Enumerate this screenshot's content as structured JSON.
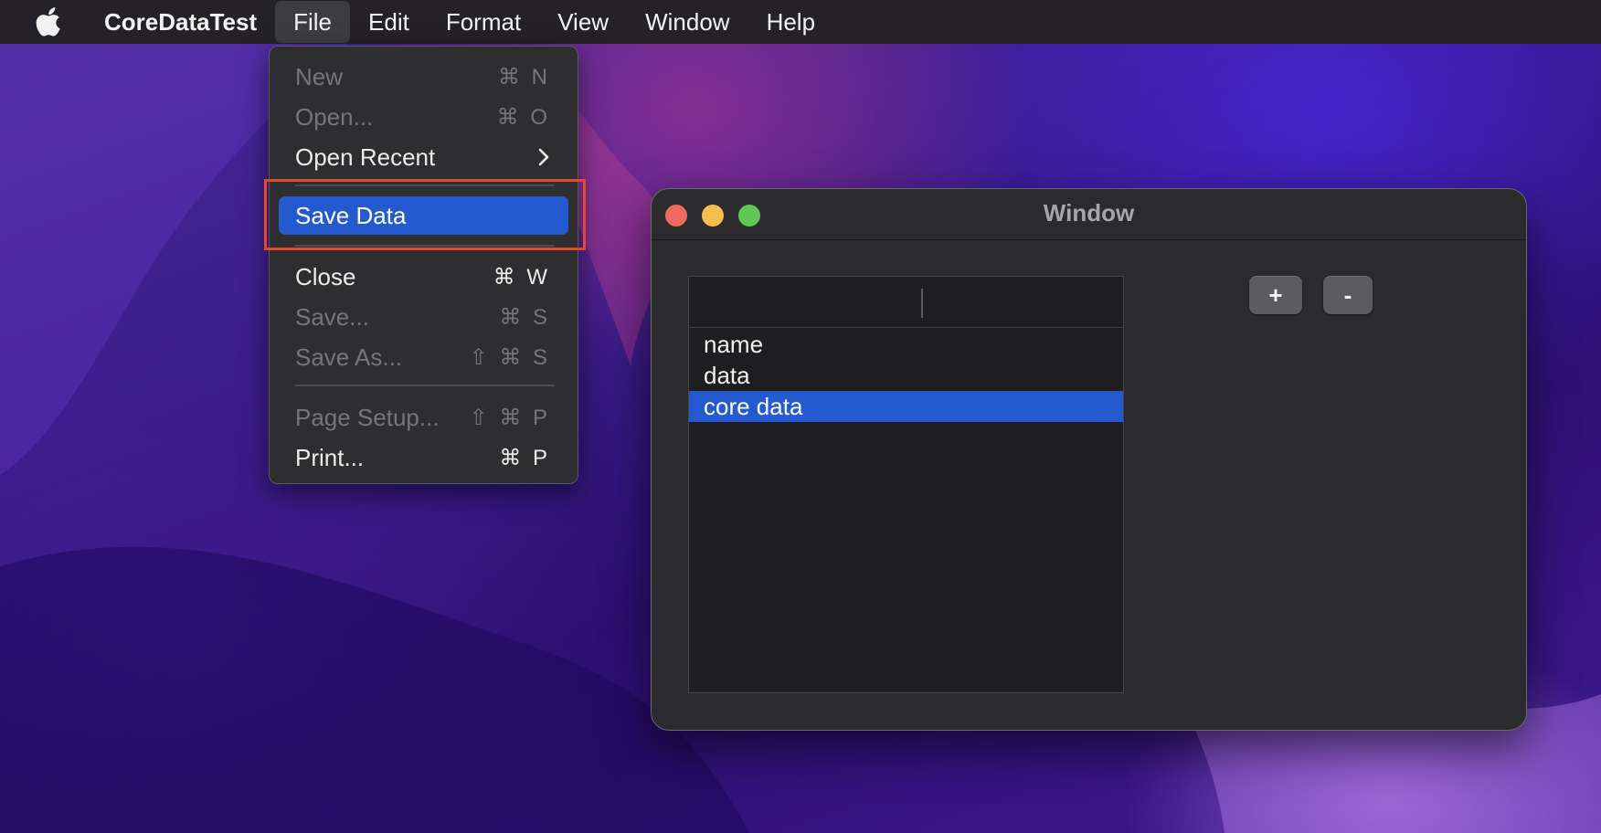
{
  "menubar": {
    "app_name": "CoreDataTest",
    "menus": [
      "File",
      "Edit",
      "Format",
      "View",
      "Window",
      "Help"
    ]
  },
  "file_menu": {
    "items": [
      {
        "label": "New",
        "shortcut": "⌘ N",
        "enabled": false
      },
      {
        "label": "Open...",
        "shortcut": "⌘ O",
        "enabled": false
      },
      {
        "label": "Open Recent",
        "shortcut": "",
        "submenu": true,
        "enabled": true
      },
      {
        "label": "Save Data",
        "shortcut": "",
        "enabled": true,
        "highlighted": true
      },
      {
        "label": "Close",
        "shortcut": "⌘ W",
        "enabled": true
      },
      {
        "label": "Save...",
        "shortcut": "⌘ S",
        "enabled": false
      },
      {
        "label": "Save As...",
        "shortcut": "⇧ ⌘ S",
        "enabled": false
      },
      {
        "label": "Page Setup...",
        "shortcut": "⇧ ⌘ P",
        "enabled": false
      },
      {
        "label": "Print...",
        "shortcut": "⌘ P",
        "enabled": true
      }
    ],
    "submenu_indicator": "chevron-right-icon"
  },
  "window": {
    "title": "Window",
    "table": {
      "rows": [
        "name",
        "data",
        "core data"
      ],
      "selected_row": "core data"
    },
    "add_label": "+",
    "remove_label": "-"
  },
  "colors": {
    "menu_highlight": "#2459d0",
    "annotation_box": "#e04a2f"
  }
}
